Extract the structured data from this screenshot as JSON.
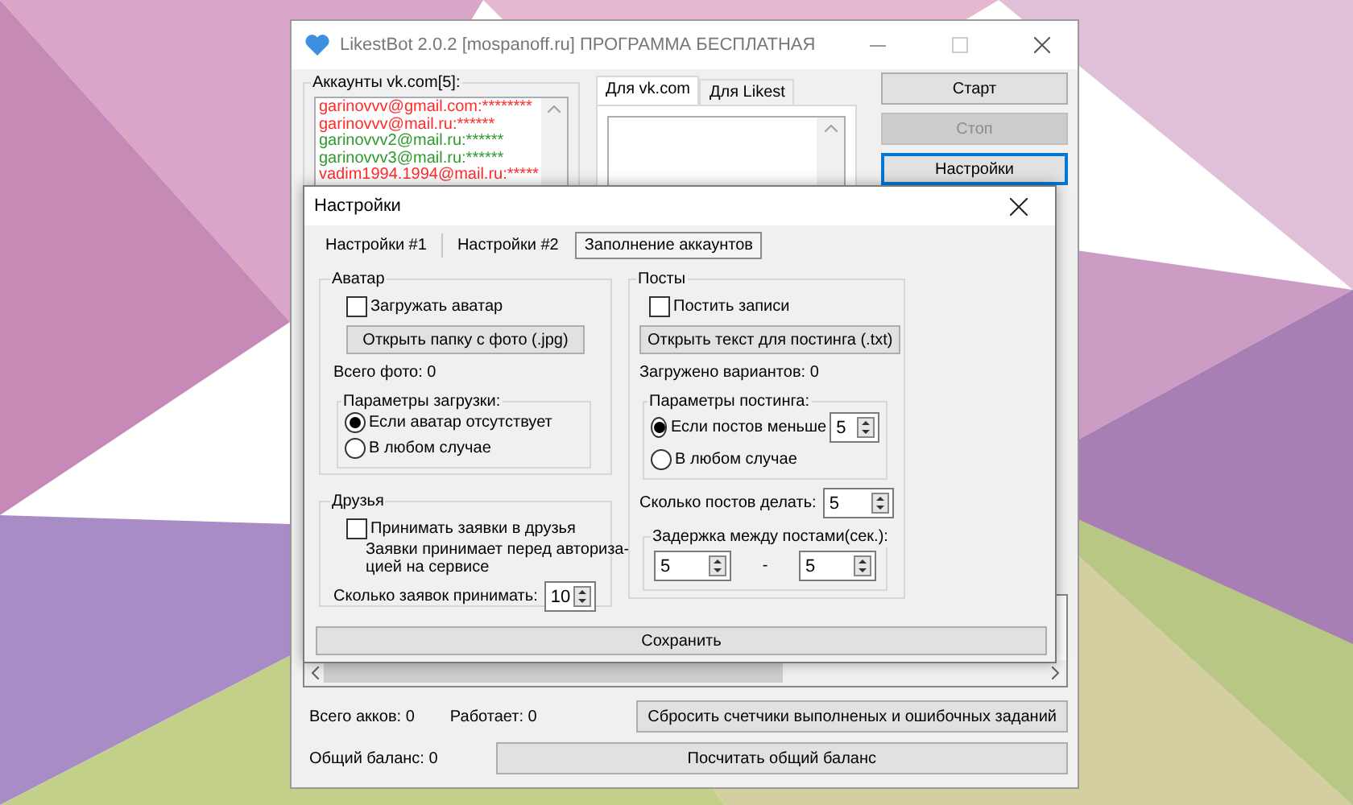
{
  "window": {
    "title": "LikestBot 2.0.2 [mospanoff.ru] ПРОГРАММА БЕСПЛАТНАЯ"
  },
  "accounts": {
    "label": "Аккаунты vk.com[5]:",
    "items": [
      {
        "login": "garinovvv@gmail.com:",
        "password": "********",
        "color": "#ff2a2a"
      },
      {
        "login": "garinovvv@mail.ru:",
        "password": "******",
        "color": "#ff2a2a"
      },
      {
        "login": "garinovvv2@mail.ru:",
        "password": "******",
        "color": "#2e9a2e"
      },
      {
        "login": "garinovvv3@mail.ru:",
        "password": "******",
        "color": "#2e9a2e"
      },
      {
        "login": "vadim1994.1994@mail.ru:",
        "password": "*****",
        "color": "#ff2a2a"
      }
    ]
  },
  "log_tabs": [
    {
      "label": "Для vk.com",
      "selected": true
    },
    {
      "label": "Для Likest",
      "selected": false
    }
  ],
  "actions": [
    {
      "label": "Старт",
      "disabled": false,
      "focused": false
    },
    {
      "label": "Стоп",
      "disabled": true,
      "focused": false
    },
    {
      "label": "Настройки",
      "disabled": false,
      "focused": true
    }
  ],
  "stats": {
    "total": "Всего акков: 0",
    "working": "Работает: 0",
    "balance": "Общий баланс: 0"
  },
  "reset_button": "Сбросить счетчики выполненых и ошибочных заданий",
  "balance_button": "Посчитать общий баланс",
  "dialog": {
    "title": "Настройки",
    "tabs": [
      {
        "label": "Настройки #1",
        "selected": false
      },
      {
        "label": "Настройки #2",
        "selected": false
      },
      {
        "label": "Заполнение аккаунтов",
        "selected": true
      }
    ],
    "avatar": {
      "title": "Аватар",
      "checkbox": {
        "label": "Загружать аватар",
        "checked": false
      },
      "open_button": "Открыть папку с фото (.jpg)",
      "count": "Всего фото: 0",
      "params": {
        "title": "Параметры загрузки:",
        "options": [
          {
            "label": "Если аватар отсутствует",
            "selected": true
          },
          {
            "label": "В любом случае",
            "selected": false
          }
        ]
      }
    },
    "friends": {
      "title": "Друзья",
      "checkbox": {
        "label": "Принимать заявки в друзья",
        "checked": false
      },
      "note": [
        "Заявки принимает перед авториза-",
        "цией на сервисе"
      ],
      "count": {
        "label": "Сколько заявок принимать:",
        "value": "10"
      }
    },
    "posts": {
      "title": "Посты",
      "checkbox": {
        "label": "Постить записи",
        "checked": false
      },
      "open_button": "Открыть текст для постинга (.txt)",
      "count": "Загружено вариантов: 0",
      "params": {
        "title": "Параметры постинга:",
        "options": [
          {
            "label": "Если постов меньше",
            "selected": true,
            "value": "5"
          },
          {
            "label": "В любом случае",
            "selected": false
          }
        ]
      },
      "posts_count": {
        "label": "Сколько постов делать:",
        "value": "5"
      },
      "delay": {
        "title": "Задержка между постами(сек.):",
        "from": "5",
        "separator": "-",
        "to": "5"
      }
    },
    "save_button": "Сохранить"
  }
}
